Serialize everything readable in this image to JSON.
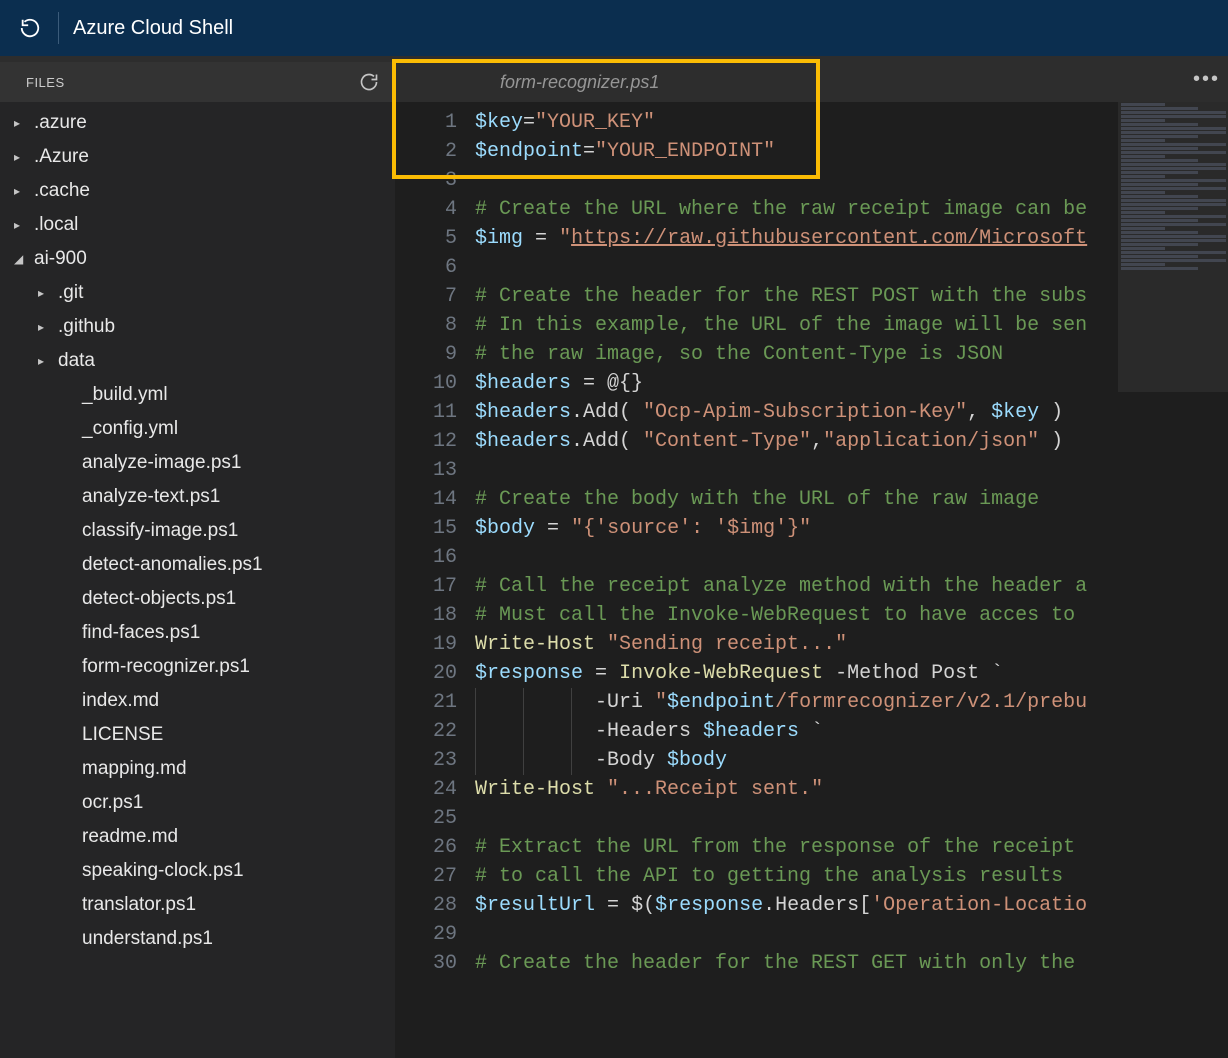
{
  "header": {
    "title": "Azure Cloud Shell"
  },
  "sidebar": {
    "header_label": "FILES",
    "tree": [
      {
        "label": ".azure",
        "depth": 0,
        "twisty": "▸"
      },
      {
        "label": ".Azure",
        "depth": 0,
        "twisty": "▸"
      },
      {
        "label": ".cache",
        "depth": 0,
        "twisty": "▸"
      },
      {
        "label": ".local",
        "depth": 0,
        "twisty": "▸"
      },
      {
        "label": "ai-900",
        "depth": 0,
        "twisty": "◢"
      },
      {
        "label": ".git",
        "depth": 1,
        "twisty": "▸"
      },
      {
        "label": ".github",
        "depth": 1,
        "twisty": "▸"
      },
      {
        "label": "data",
        "depth": 1,
        "twisty": "▸"
      },
      {
        "label": "_build.yml",
        "depth": 2,
        "twisty": ""
      },
      {
        "label": "_config.yml",
        "depth": 2,
        "twisty": ""
      },
      {
        "label": "analyze-image.ps1",
        "depth": 2,
        "twisty": ""
      },
      {
        "label": "analyze-text.ps1",
        "depth": 2,
        "twisty": ""
      },
      {
        "label": "classify-image.ps1",
        "depth": 2,
        "twisty": ""
      },
      {
        "label": "detect-anomalies.ps1",
        "depth": 2,
        "twisty": ""
      },
      {
        "label": "detect-objects.ps1",
        "depth": 2,
        "twisty": ""
      },
      {
        "label": "find-faces.ps1",
        "depth": 2,
        "twisty": ""
      },
      {
        "label": "form-recognizer.ps1",
        "depth": 2,
        "twisty": ""
      },
      {
        "label": "index.md",
        "depth": 2,
        "twisty": ""
      },
      {
        "label": "LICENSE",
        "depth": 2,
        "twisty": ""
      },
      {
        "label": "mapping.md",
        "depth": 2,
        "twisty": ""
      },
      {
        "label": "ocr.ps1",
        "depth": 2,
        "twisty": ""
      },
      {
        "label": "readme.md",
        "depth": 2,
        "twisty": ""
      },
      {
        "label": "speaking-clock.ps1",
        "depth": 2,
        "twisty": ""
      },
      {
        "label": "translator.ps1",
        "depth": 2,
        "twisty": ""
      },
      {
        "label": "understand.ps1",
        "depth": 2,
        "twisty": ""
      }
    ]
  },
  "editor": {
    "tab_label": "form-recognizer.ps1",
    "lines": [
      {
        "n": 1,
        "tokens": [
          [
            "var",
            "$key"
          ],
          [
            "op",
            "="
          ],
          [
            "str",
            "\"YOUR_KEY\""
          ]
        ]
      },
      {
        "n": 2,
        "tokens": [
          [
            "var",
            "$endpoint"
          ],
          [
            "op",
            "="
          ],
          [
            "str",
            "\"YOUR_ENDPOINT\""
          ]
        ]
      },
      {
        "n": 3,
        "tokens": []
      },
      {
        "n": 4,
        "tokens": [
          [
            "comment",
            "# Create the URL where the raw receipt image can be"
          ]
        ]
      },
      {
        "n": 5,
        "tokens": [
          [
            "var",
            "$img"
          ],
          [
            "ident",
            " "
          ],
          [
            "op",
            "="
          ],
          [
            "ident",
            " "
          ],
          [
            "str",
            "\""
          ],
          [
            "url",
            "https://raw.githubusercontent.com/Microsoft"
          ]
        ]
      },
      {
        "n": 6,
        "tokens": []
      },
      {
        "n": 7,
        "tokens": [
          [
            "comment",
            "# Create the header for the REST POST with the subs"
          ]
        ]
      },
      {
        "n": 8,
        "tokens": [
          [
            "comment",
            "# In this example, the URL of the image will be sen"
          ]
        ]
      },
      {
        "n": 9,
        "tokens": [
          [
            "comment",
            "# the raw image, so the Content-Type is JSON"
          ]
        ]
      },
      {
        "n": 10,
        "tokens": [
          [
            "var",
            "$headers"
          ],
          [
            "ident",
            " "
          ],
          [
            "op",
            "="
          ],
          [
            "ident",
            " @{}"
          ]
        ]
      },
      {
        "n": 11,
        "tokens": [
          [
            "var",
            "$headers"
          ],
          [
            "ident",
            ".Add( "
          ],
          [
            "str",
            "\"Ocp-Apim-Subscription-Key\""
          ],
          [
            "ident",
            ", "
          ],
          [
            "var",
            "$key"
          ],
          [
            "ident",
            " )"
          ]
        ]
      },
      {
        "n": 12,
        "tokens": [
          [
            "var",
            "$headers"
          ],
          [
            "ident",
            ".Add( "
          ],
          [
            "str",
            "\"Content-Type\""
          ],
          [
            "ident",
            ","
          ],
          [
            "str",
            "\"application/json\""
          ],
          [
            "ident",
            " )"
          ]
        ]
      },
      {
        "n": 13,
        "tokens": []
      },
      {
        "n": 14,
        "tokens": [
          [
            "comment",
            "# Create the body with the URL of the raw image"
          ]
        ]
      },
      {
        "n": 15,
        "tokens": [
          [
            "var",
            "$body"
          ],
          [
            "ident",
            " "
          ],
          [
            "op",
            "="
          ],
          [
            "ident",
            " "
          ],
          [
            "str",
            "\"{'source': '$img'}\""
          ]
        ]
      },
      {
        "n": 16,
        "tokens": []
      },
      {
        "n": 17,
        "tokens": [
          [
            "comment",
            "# Call the receipt analyze method with the header a"
          ]
        ]
      },
      {
        "n": 18,
        "tokens": [
          [
            "comment",
            "# Must call the Invoke-WebRequest to have acces to "
          ]
        ]
      },
      {
        "n": 19,
        "tokens": [
          [
            "cmd",
            "Write-Host "
          ],
          [
            "str",
            "\"Sending receipt...\""
          ]
        ]
      },
      {
        "n": 20,
        "tokens": [
          [
            "var",
            "$response"
          ],
          [
            "ident",
            " "
          ],
          [
            "op",
            "="
          ],
          [
            "ident",
            " "
          ],
          [
            "cmd",
            "Invoke-WebRequest"
          ],
          [
            "ident",
            " -Method Post `"
          ]
        ]
      },
      {
        "n": 21,
        "tokens": [
          [
            "ident",
            "          -Uri "
          ],
          [
            "str",
            "\""
          ],
          [
            "var",
            "$endpoint"
          ],
          [
            "str",
            "/formrecognizer/v2.1/prebu"
          ]
        ],
        "guides": [
          0,
          48,
          96
        ]
      },
      {
        "n": 22,
        "tokens": [
          [
            "ident",
            "          -Headers "
          ],
          [
            "var",
            "$headers"
          ],
          [
            "ident",
            " `"
          ]
        ],
        "guides": [
          0,
          48,
          96
        ]
      },
      {
        "n": 23,
        "tokens": [
          [
            "ident",
            "          -Body "
          ],
          [
            "var",
            "$body"
          ]
        ],
        "guides": [
          0,
          48,
          96
        ]
      },
      {
        "n": 24,
        "tokens": [
          [
            "cmd",
            "Write-Host "
          ],
          [
            "str",
            "\"...Receipt sent.\""
          ]
        ]
      },
      {
        "n": 25,
        "tokens": []
      },
      {
        "n": 26,
        "tokens": [
          [
            "comment",
            "# Extract the URL from the response of the receipt "
          ]
        ]
      },
      {
        "n": 27,
        "tokens": [
          [
            "comment",
            "# to call the API to getting the analysis results"
          ]
        ]
      },
      {
        "n": 28,
        "tokens": [
          [
            "var",
            "$resultUrl"
          ],
          [
            "ident",
            " "
          ],
          [
            "op",
            "="
          ],
          [
            "ident",
            " $("
          ],
          [
            "var",
            "$response"
          ],
          [
            "ident",
            ".Headers["
          ],
          [
            "str",
            "'Operation-Locatio"
          ]
        ]
      },
      {
        "n": 29,
        "tokens": []
      },
      {
        "n": 30,
        "tokens": [
          [
            "comment",
            "# Create the header for the REST GET with only the "
          ]
        ]
      }
    ]
  }
}
